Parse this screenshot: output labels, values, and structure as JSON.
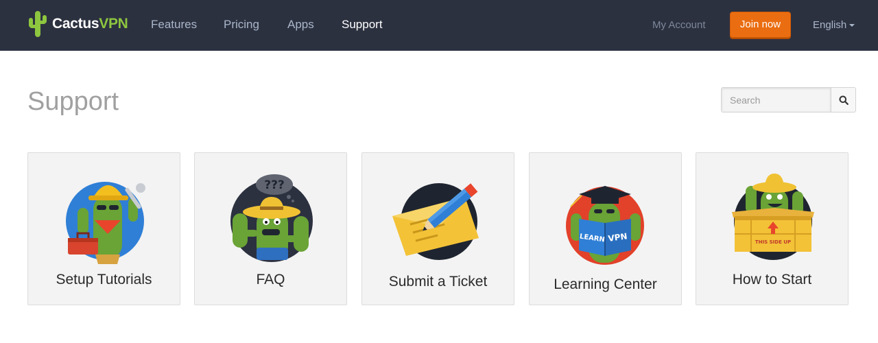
{
  "brand": {
    "name_part1": "Cactus",
    "name_part2": "VPN",
    "accent": "#8dc63f"
  },
  "nav": {
    "links": [
      "Features",
      "Pricing",
      "Apps",
      "Support"
    ],
    "active": "Support",
    "account": "My Account",
    "join": "Join now",
    "language": "English"
  },
  "page": {
    "title": "Support"
  },
  "search": {
    "placeholder": "Search",
    "icon": "search-icon"
  },
  "cards": [
    {
      "label": "Setup Tutorials",
      "icon": "cactus-builder-toolbox-illustration",
      "circle_color": "#2f7fd6"
    },
    {
      "label": "FAQ",
      "icon": "cactus-question-marks-illustration",
      "circle_color": "#2c3140"
    },
    {
      "label": "Submit a Ticket",
      "icon": "pencil-envelope-illustration",
      "circle_color": "#2c3140"
    },
    {
      "label": "Learning Center",
      "icon": "cactus-reading-book-illustration",
      "circle_color": "#e2412a",
      "book_text_1": "LEARN",
      "book_text_2": "VPN"
    },
    {
      "label": "How to Start",
      "icon": "cactus-in-box-illustration",
      "circle_color": "#2c3140",
      "box_text": "THIS SIDE UP"
    }
  ],
  "colors": {
    "nav_bg": "#2c3140",
    "join_bg": "#ea6d11",
    "card_bg": "#f3f3f3",
    "title": "#a0a0a0"
  }
}
